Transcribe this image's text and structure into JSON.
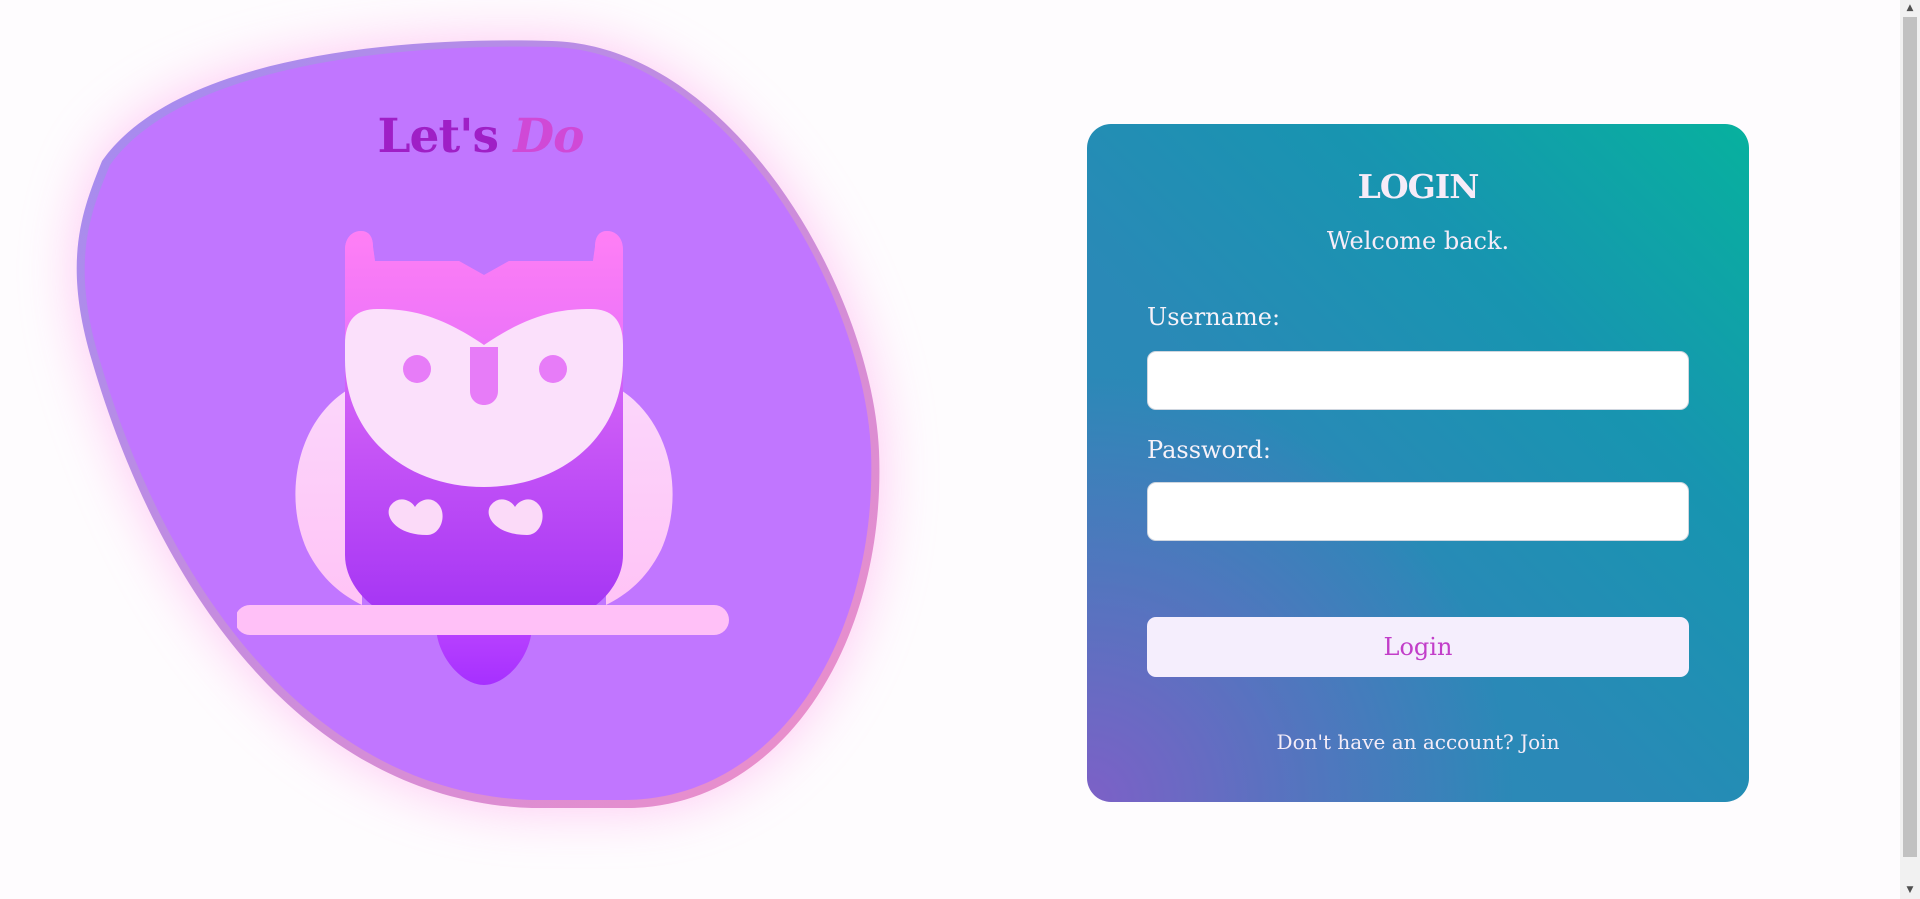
{
  "brand": {
    "part1": "Let's",
    "part2": "Do",
    "logo_icon": "owl-icon"
  },
  "colors": {
    "blob": "#c176ff",
    "brand_text": "#9f1fc6",
    "card_gradient_start": "#07b19e",
    "card_gradient_end": "#815ec8",
    "button_bg": "#f5eefd",
    "button_text": "#c23ec9"
  },
  "login": {
    "title": "LOGIN",
    "subtitle": "Welcome back.",
    "username_label": "Username:",
    "username_value": "",
    "password_label": "Password:",
    "password_value": "",
    "button_label": "Login",
    "join_prompt": "Don't have an account?",
    "join_link": "Join"
  }
}
